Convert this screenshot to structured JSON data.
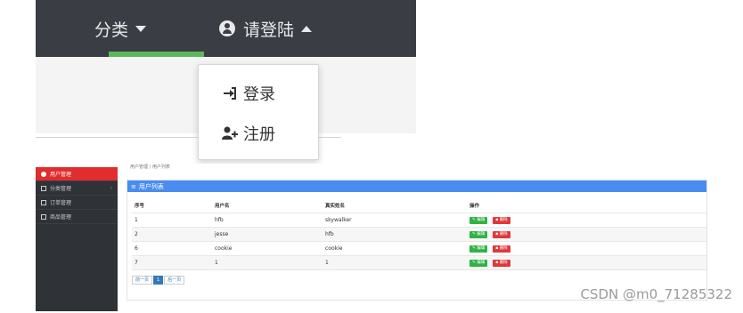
{
  "navbar": {
    "category_label": "分类",
    "login_label": "请登陆"
  },
  "dropdown": {
    "login_label": "登录",
    "register_label": "注册"
  },
  "admin": {
    "breadcrumb": "用户管理 / 用户列表",
    "sidebar": [
      {
        "label": "用户管理",
        "icon": "user-circle-icon",
        "active": true
      },
      {
        "label": "分类管理",
        "icon": "grid-icon",
        "active": false
      },
      {
        "label": "订单管理",
        "icon": "file-icon",
        "active": false
      },
      {
        "label": "商品管理",
        "icon": "shop-icon",
        "active": false
      }
    ],
    "panel_title": "用户列表",
    "table": {
      "headers": [
        "序号",
        "用户名",
        "真实姓名",
        "操作"
      ],
      "rows": [
        {
          "id": "1",
          "username": "hfb",
          "realname": "skywalker"
        },
        {
          "id": "2",
          "username": "jesse",
          "realname": "hfb"
        },
        {
          "id": "6",
          "username": "cookie",
          "realname": "cookie"
        },
        {
          "id": "7",
          "username": "1",
          "realname": "1"
        }
      ],
      "edit_label": "编辑",
      "delete_label": "删除"
    },
    "pagination": {
      "prev": "前一页",
      "current": "1",
      "next": "后一页"
    }
  },
  "colors": {
    "navbar_bg": "#3a3d44",
    "active_underline": "#5cb85c",
    "sidebar_bg": "#2f3237",
    "sidebar_active": "#e02d2d",
    "panel_heading": "#4a8cf0",
    "edit_button": "#2fb344",
    "delete_button": "#e0383a"
  },
  "watermark": "CSDN @m0_71285322"
}
